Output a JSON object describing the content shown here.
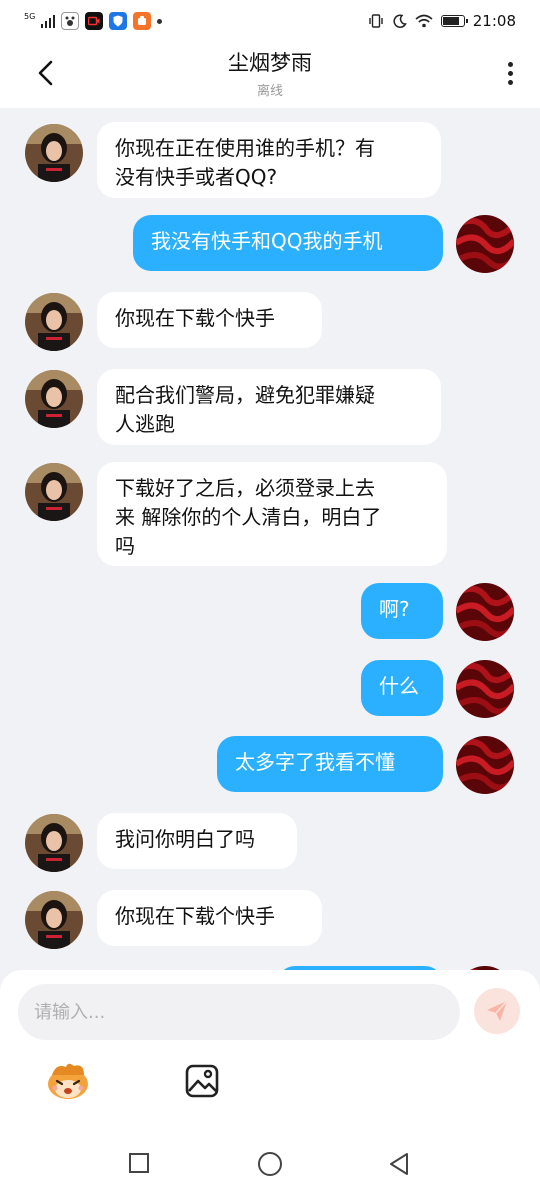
{
  "status_bar": {
    "network": "5G",
    "time": "21:08"
  },
  "header": {
    "title": "尘烟梦雨",
    "subtitle": "离线"
  },
  "messages": [
    {
      "side": "in",
      "lines": [
        "你现在正在使用谁的手机？有",
        "没有快手或者QQ?"
      ]
    },
    {
      "side": "out",
      "lines": [
        "我没有快手和QQ我的手机"
      ]
    },
    {
      "side": "in",
      "lines": [
        "你现在下载个快手"
      ]
    },
    {
      "side": "in",
      "lines": [
        "配合我们警局，避免犯罪嫌疑",
        "人逃跑"
      ]
    },
    {
      "side": "in",
      "lines": [
        "下载好了之后，必须登录上去",
        "来 解除你的个人清白，明白了",
        "吗"
      ]
    },
    {
      "side": "out",
      "lines": [
        "啊?"
      ]
    },
    {
      "side": "out",
      "lines": [
        "什么"
      ]
    },
    {
      "side": "out",
      "lines": [
        "太多字了我看不懂"
      ]
    },
    {
      "side": "in",
      "lines": [
        "我问你明白了吗"
      ]
    },
    {
      "side": "in",
      "lines": [
        "你现在下载个快手"
      ]
    }
  ],
  "composer": {
    "placeholder": "请输入..."
  },
  "colors": {
    "outgoing_bubble": "#2bb0ff",
    "incoming_bubble": "#ffffff",
    "chat_background": "#f1f2f6",
    "send_button": "#fbe3dd"
  }
}
